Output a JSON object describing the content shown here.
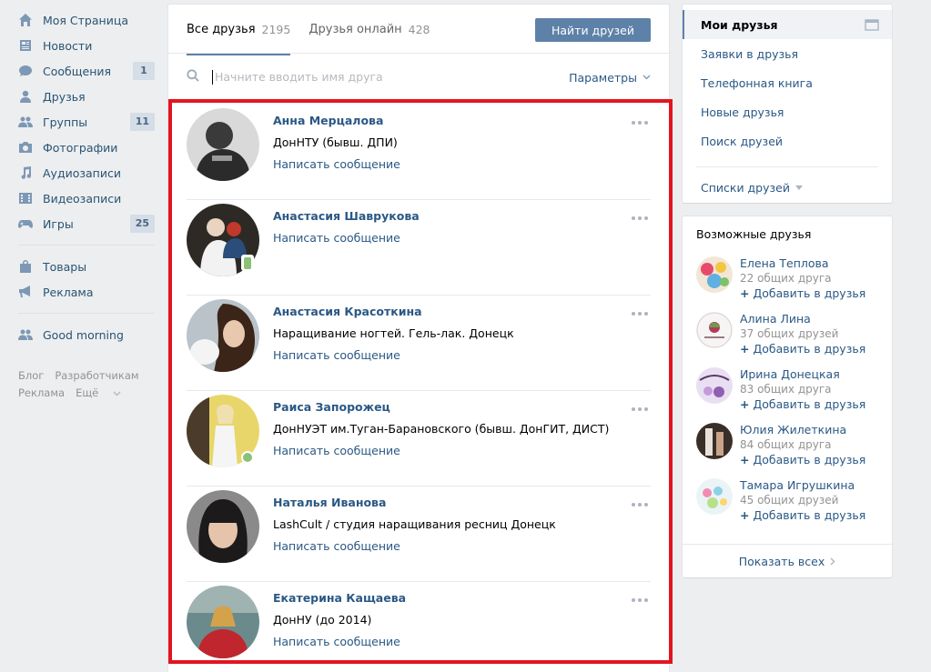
{
  "leftnav": {
    "items": [
      {
        "label": "Моя Страница",
        "icon": "home-icon",
        "badge": ""
      },
      {
        "label": "Новости",
        "icon": "news-icon",
        "badge": ""
      },
      {
        "label": "Сообщения",
        "icon": "messages-icon",
        "badge": "1"
      },
      {
        "label": "Друзья",
        "icon": "friends-icon",
        "badge": ""
      },
      {
        "label": "Группы",
        "icon": "groups-icon",
        "badge": "11"
      },
      {
        "label": "Фотографии",
        "icon": "photo-icon",
        "badge": ""
      },
      {
        "label": "Аудиозаписи",
        "icon": "music-icon",
        "badge": ""
      },
      {
        "label": "Видеозаписи",
        "icon": "video-icon",
        "badge": ""
      },
      {
        "label": "Игры",
        "icon": "games-icon",
        "badge": "25"
      }
    ],
    "secondary": [
      {
        "label": "Товары",
        "icon": "bag-icon"
      },
      {
        "label": "Реклама",
        "icon": "megaphone-icon"
      }
    ],
    "apps": [
      {
        "label": "Good morning",
        "icon": "app-icon"
      }
    ],
    "footer": {
      "blog": "Блог",
      "devs": "Разработчикам",
      "ads": "Реклама",
      "more": "Ещё"
    }
  },
  "main": {
    "tabs": [
      {
        "label": "Все друзья",
        "count": "2195"
      },
      {
        "label": "Друзья онлайн",
        "count": "428"
      }
    ],
    "find_button": "Найти друзей",
    "search": {
      "placeholder": "Начните вводить имя друга",
      "value": ""
    },
    "params_label": "Параметры",
    "friends": [
      {
        "name": "Анна Мерцалова",
        "info": "ДонНТУ (бывш. ДПИ)",
        "msg": "Написать сообщение",
        "status": "none"
      },
      {
        "name": "Анастасия Шаврукова",
        "info": "",
        "msg": "Написать сообщение",
        "status": "mobile"
      },
      {
        "name": "Анастасия Красоткина",
        "info": "Наращивание ногтей. Гель-лак. Донецк",
        "msg": "Написать сообщение",
        "status": "none"
      },
      {
        "name": "Раиса Запорожец",
        "info": "ДонНУЭТ им.Туган-Барановского (бывш. ДонГИТ, ДИСТ)",
        "msg": "Написать сообщение",
        "status": "online"
      },
      {
        "name": "Наталья Иванова",
        "info": "LashCult / студия наращивания ресниц Донецк",
        "msg": "Написать сообщение",
        "status": "none"
      },
      {
        "name": "Екатерина Кащаева",
        "info": "ДонНУ (до 2014)",
        "msg": "Написать сообщение",
        "status": "none"
      }
    ]
  },
  "rightmenu": {
    "items": [
      {
        "label": "Мои друзья",
        "active": true
      },
      {
        "label": "Заявки в друзья",
        "active": false
      },
      {
        "label": "Телефонная книга",
        "active": false
      },
      {
        "label": "Новые друзья",
        "active": false
      },
      {
        "label": "Поиск друзей",
        "active": false
      }
    ],
    "lists_label": "Списки друзей"
  },
  "possible": {
    "title": "Возможные друзья",
    "add_label": "Добавить в друзья",
    "people": [
      {
        "name": "Елена Теплова",
        "mutual": "22 общих друга"
      },
      {
        "name": "Алина Лина",
        "mutual": "37 общих друзей"
      },
      {
        "name": "Ирина Донецкая",
        "mutual": "83 общих друга"
      },
      {
        "name": "Юлия Жилеткина",
        "mutual": "84 общих друга"
      },
      {
        "name": "Тамара Игрушкина",
        "mutual": "45 общих друзей"
      }
    ],
    "show_all": "Показать всех"
  },
  "colors": {
    "accent": "#5e81a8",
    "link": "#2a5885",
    "highlight": "#e3141f",
    "online": "#8ac176"
  }
}
